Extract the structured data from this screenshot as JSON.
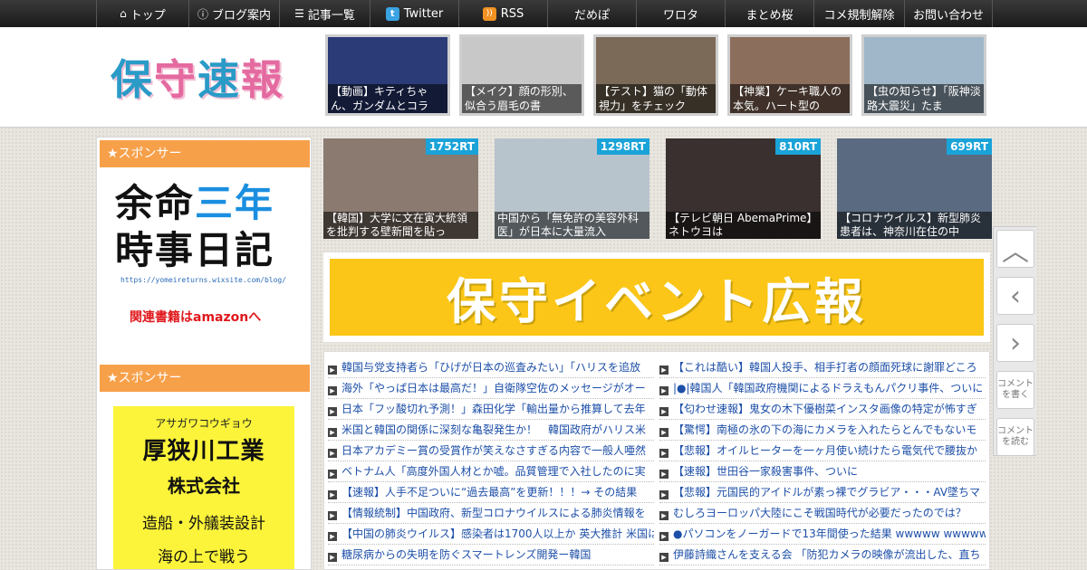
{
  "nav": [
    {
      "label": "トップ",
      "icon": "home-icon",
      "w": 102
    },
    {
      "label": "ブログ案内",
      "icon": "info-icon",
      "w": 100
    },
    {
      "label": "記事一覧",
      "icon": "list-icon",
      "w": 100
    },
    {
      "label": "Twitter",
      "icon": "twitter-icon",
      "w": 98
    },
    {
      "label": "RSS",
      "icon": "rss-icon",
      "w": 98
    },
    {
      "label": "だめぽ",
      "icon": "",
      "w": 98
    },
    {
      "label": "ワロタ",
      "icon": "",
      "w": 98
    },
    {
      "label": "まとめ桜",
      "icon": "",
      "w": 98
    },
    {
      "label": "コメ規制解除",
      "icon": "",
      "w": 100
    },
    {
      "label": "お問い合わせ",
      "icon": "",
      "w": 98
    }
  ],
  "logo": {
    "c1": "保",
    "c2": "守",
    "c3": "速",
    "c4": "報"
  },
  "header_thumbs": [
    {
      "caption": "【動画】キティちゃん、ガンダムとコラ",
      "color": "#2a3b78"
    },
    {
      "caption": "【メイク】顔の形別、似合う眉毛の書",
      "color": "#c8c8c8"
    },
    {
      "caption": "【テスト】猫の「動体視力」をチェック",
      "color": "#7b6a58"
    },
    {
      "caption": "【神業】ケーキ職人の本気。ハート型の",
      "color": "#8c6e5c"
    },
    {
      "caption": "【虫の知らせ】「阪神淡路大震災」たま",
      "color": "#9fb7c8"
    }
  ],
  "sidebar": {
    "sponsor1": "★スポンサー",
    "ad1": {
      "l1": "余命",
      "l1b": "三年",
      "l2": "時事日記",
      "url": "https://yomeireturns.wixsite.com/blog/",
      "amazon": "関連書籍はamazonへ"
    },
    "sponsor2": "★スポンサー",
    "ad2": {
      "kana": "アサガワコウギョウ",
      "name": "厚狭川工業",
      "co": "株式会社",
      "desc": "造船・外艤装設計",
      "more": "海の上で戦う"
    }
  },
  "rt_thumbs": [
    {
      "badge": "1752RT",
      "caption": "【韓国】大学に文在寅大統領を批判する壁新聞を貼っ",
      "color": "#8a7a70"
    },
    {
      "badge": "1298RT",
      "caption": "中国から「無免許の美容外科医」が日本に大量流入",
      "color": "#b8c4cc"
    },
    {
      "badge": "810RT",
      "caption": "【テレビ朝日 AbemaPrime】ネトウヨは",
      "color": "#3a3030"
    },
    {
      "badge": "699RT",
      "caption": "【コロナウイルス】新型肺炎患者は、神奈川在住の中",
      "color": "#5a6a80"
    }
  ],
  "banner": {
    "text": "保守イベント広報"
  },
  "news_left": [
    "韓国与党支持者ら「ひげが日本の巡査みたい」「ハリスを追放",
    "海外「やっぱ日本は最高だ！」自衛隊空佐のメッセージがオー",
    "日本「フッ酸切れ予測！」森田化学「輸出量から推算して去年",
    "米国と韓国の関係に深刻な亀裂発生か！　韓国政府がハリス米",
    "日本アカデミー賞の受賞作が笑えなさすぎる内容で一般人唖然",
    "ベトナム人「高度外国人材とか嘘。品質管理で入社したのに実",
    "【速報】人手不足ついに“過去最高”を更新！！！→ その結果",
    "【情報統制】中国政府、新型コロナウイルスによる肺炎情報を",
    "【中国の肺炎ウイルス】感染者は1700人以上か 英大推計 米国は",
    "糖尿病からの失明を防ぐスマートレンズ開発ー韓国"
  ],
  "news_right": [
    "【これは酷い】韓国人投手、相手打者の顔面死球に謝罪どころ",
    "|●|韓国人「韓国政府機関によるドラえもんパクリ事件、ついに",
    "【匂わせ速報】鬼女の木下優樹菜インスタ画像の特定が怖すぎ",
    "【驚愕】南極の氷の下の海にカメラを入れたらとんでもないモ",
    "【悲報】オイルヒーターを一ヶ月使い続けたら電気代で腰抜か",
    "【速報】世田谷一家殺害事件、ついに",
    "【悲報】元国民的アイドルが素っ裸でグラビア・・・AV墜ちマ",
    "むしろヨーロッパ大陸にこそ戦国時代が必要だったのでは？",
    "●パソコンをノーガードで13年間使った結果 wwwww wwwww",
    "伊藤詩織さんを支える会 「防犯カメラの映像が流出した、直ち"
  ],
  "float": {
    "write": "コメントを書く",
    "read": "コメントを読む"
  }
}
